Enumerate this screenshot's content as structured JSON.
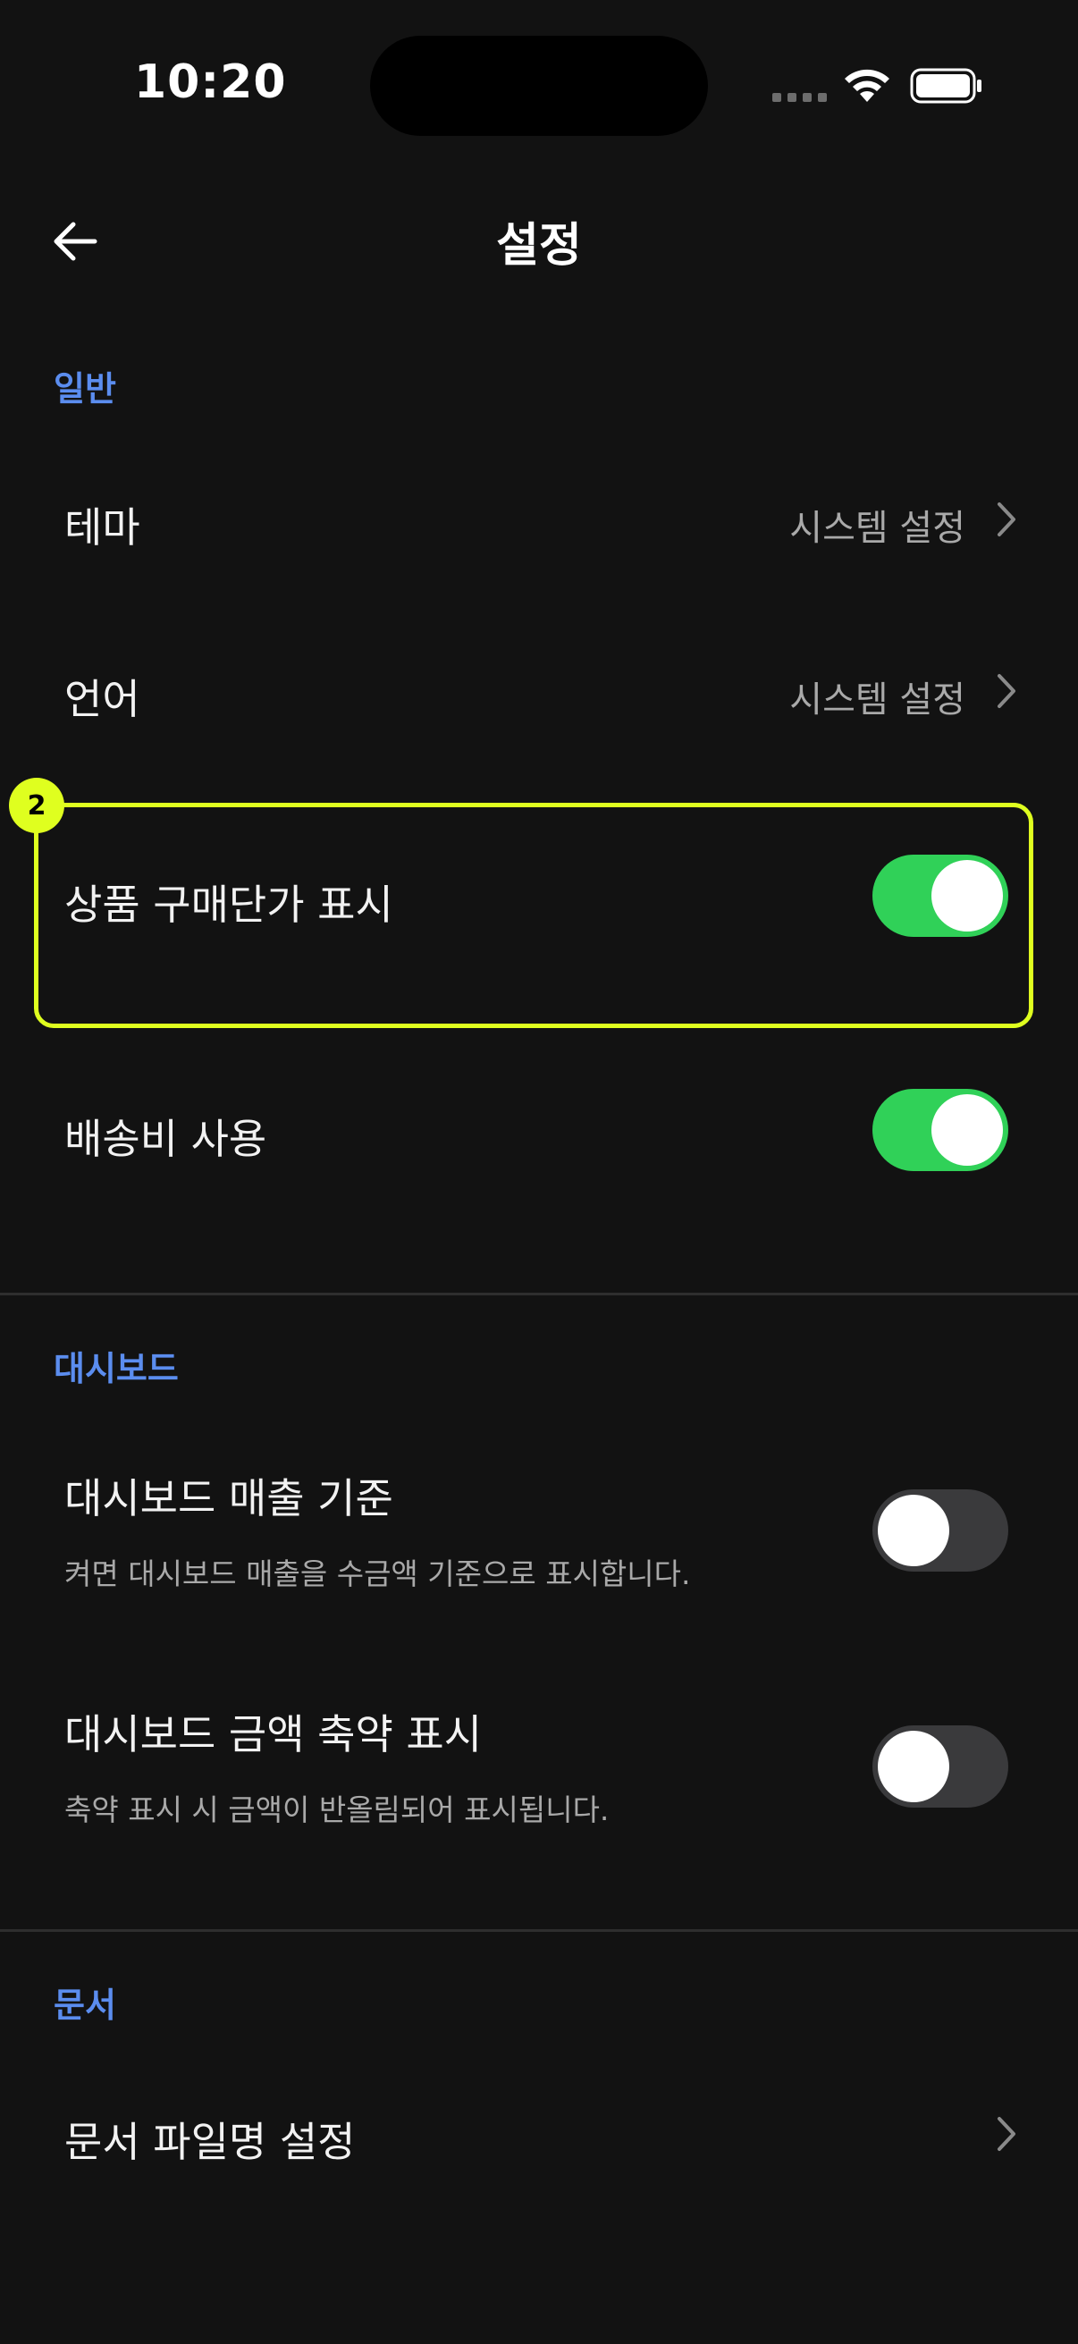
{
  "status_bar": {
    "time": "10:20"
  },
  "nav": {
    "title": "설정",
    "back_icon": "arrow-left-icon"
  },
  "sections": {
    "general": {
      "header": "일반",
      "theme": {
        "label": "테마",
        "value": "시스템 설정"
      },
      "language": {
        "label": "언어",
        "value": "시스템 설정"
      },
      "show_purchase_price": {
        "label": "상품 구매단가 표시",
        "on": true
      },
      "use_shipping_fee": {
        "label": "배송비 사용",
        "on": true
      }
    },
    "dashboard": {
      "header": "대시보드",
      "sales_basis": {
        "label": "대시보드 매출 기준",
        "sub": "켜면 대시보드 매출을 수금액 기준으로 표시합니다.",
        "on": false
      },
      "abbreviate_amount": {
        "label": "대시보드 금액 축약 표시",
        "sub": "축약 표시 시 금액이 반올림되어 표시됩니다.",
        "on": false
      }
    },
    "documents": {
      "header": "문서",
      "filename_setting": {
        "label": "문서 파일명 설정"
      }
    }
  },
  "annotation": {
    "badge": "2"
  },
  "colors": {
    "accent": "#5b8def",
    "toggle_on": "#30d158",
    "toggle_off": "#3a3a3c",
    "highlight": "#dfff1f",
    "background": "#121212"
  }
}
